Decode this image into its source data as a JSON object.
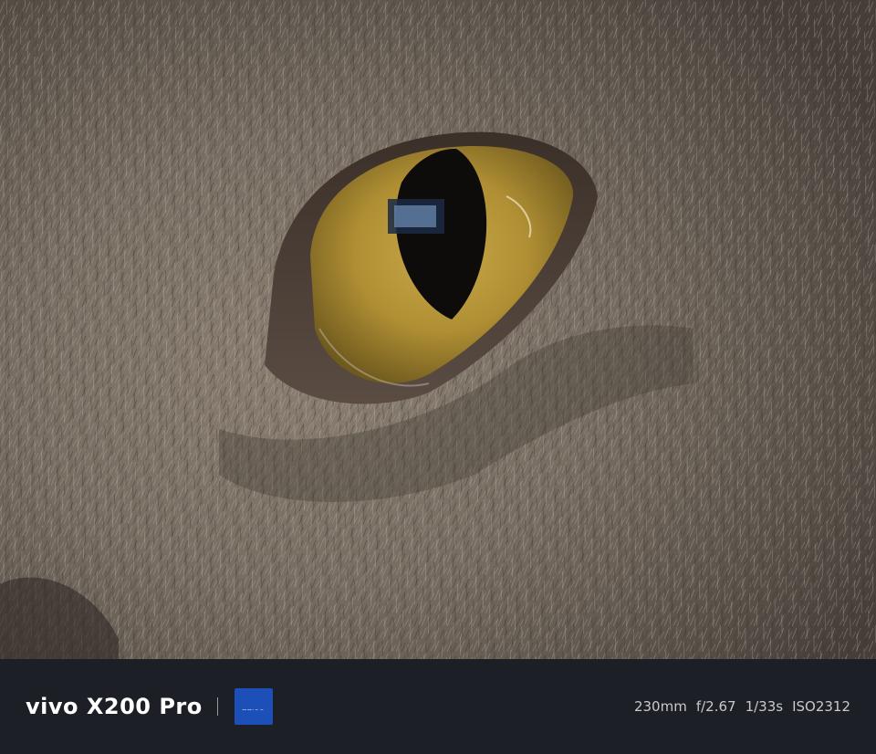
{
  "photo": {
    "subject": "cat-eye-closeup"
  },
  "watermark": {
    "brand": "vivo X200 Pro",
    "lens_logo_text": "ZEISS",
    "focal_length": "230mm",
    "aperture": "f/2.67",
    "shutter": "1/33s",
    "iso": "ISO2312"
  },
  "colors": {
    "footer_bg": "#1d1f26",
    "zeiss_blue": "#1c4fb8",
    "iris": "#b89a3a"
  }
}
